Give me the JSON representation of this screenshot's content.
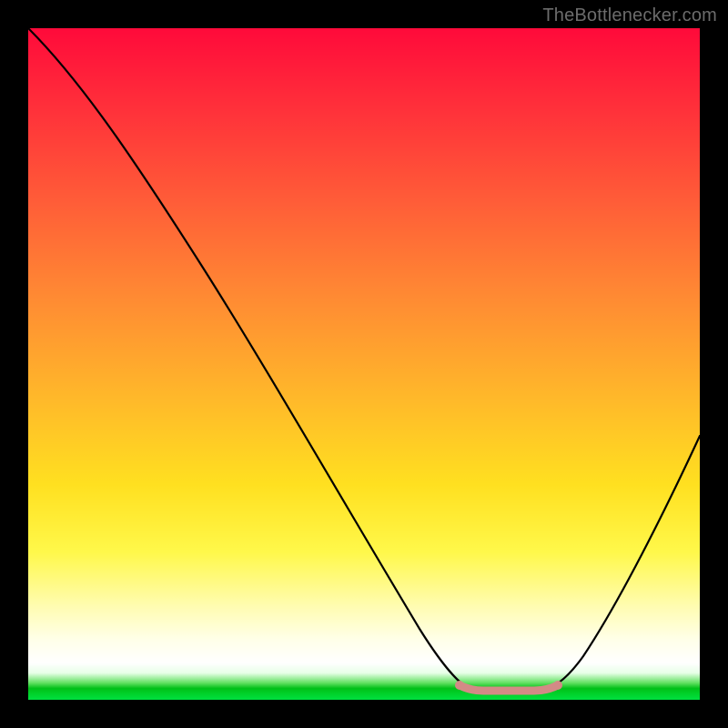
{
  "attribution": "TheBottlenecker.com",
  "gradient": {
    "top": "#ff0a3a",
    "mid": "#ffe020",
    "green": "#00c018"
  },
  "chart_data": {
    "type": "line",
    "title": "",
    "xlabel": "",
    "ylabel": "",
    "xlim": [
      0,
      100
    ],
    "ylim": [
      0,
      100
    ],
    "series": [
      {
        "name": "bottleneck-curve",
        "x": [
          0,
          5,
          10,
          15,
          20,
          25,
          30,
          35,
          40,
          45,
          50,
          55,
          60,
          64,
          68,
          72,
          76,
          80,
          84,
          88,
          92,
          96,
          100
        ],
        "values": [
          100,
          92,
          84,
          76,
          68,
          60,
          52,
          44,
          36,
          28,
          20,
          12,
          5,
          1,
          0,
          0,
          0,
          1,
          7,
          16,
          26,
          36,
          46
        ]
      }
    ],
    "annotations": [
      {
        "name": "optimal-range",
        "x_start": 64,
        "x_end": 80,
        "color": "#d38a86"
      }
    ],
    "description": "V-shaped bottleneck curve: descends from 100% at x=0 to ~0 around x=68–78 (flat trough marked in salmon), then rises to ~46% at x=100.",
    "grid": false,
    "legend": false
  }
}
